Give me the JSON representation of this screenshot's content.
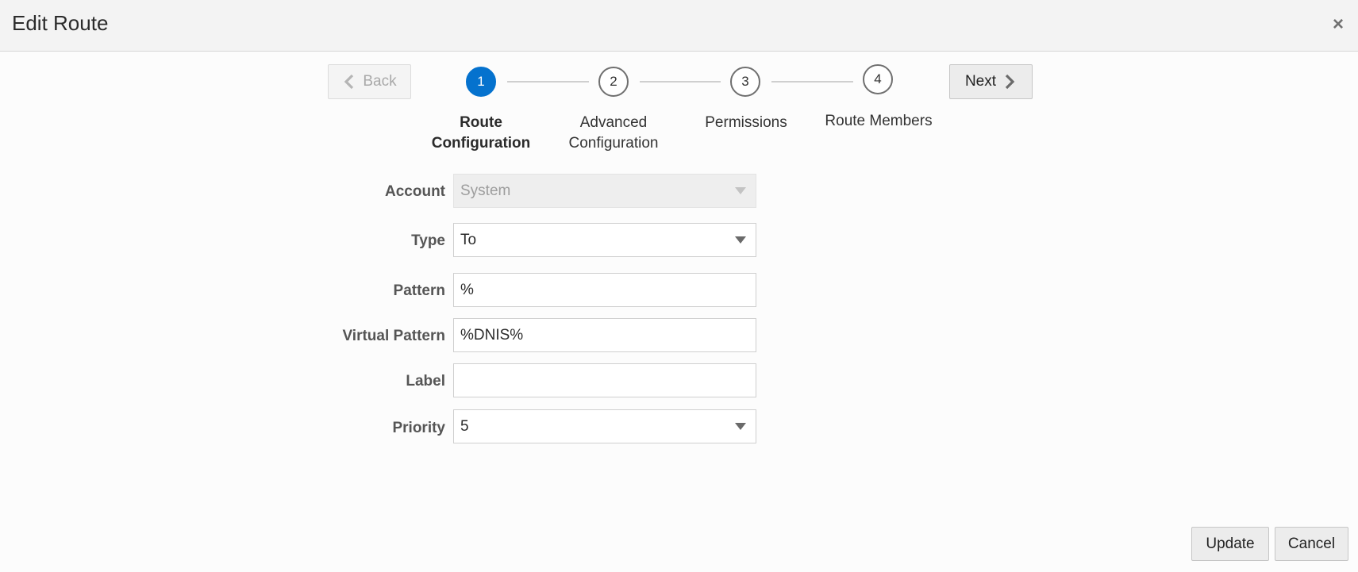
{
  "dialog": {
    "title": "Edit Route",
    "close_glyph": "×"
  },
  "nav": {
    "back_label": "Back",
    "next_label": "Next"
  },
  "steps": [
    {
      "number": "1",
      "label_line1": "Route",
      "label_line2": "Configuration",
      "active": true
    },
    {
      "number": "2",
      "label_line1": "Advanced",
      "label_line2": "Configuration",
      "active": false
    },
    {
      "number": "3",
      "label_line1": "Permissions",
      "label_line2": "",
      "active": false
    },
    {
      "number": "4",
      "label_line1": "Route Members",
      "label_line2": "",
      "active": false
    }
  ],
  "form": {
    "account": {
      "label": "Account",
      "value": "System",
      "disabled": true
    },
    "type": {
      "label": "Type",
      "value": "To"
    },
    "pattern": {
      "label": "Pattern",
      "value": "%"
    },
    "virtual_pattern": {
      "label": "Virtual Pattern",
      "value": "%DNIS%"
    },
    "label": {
      "label": "Label",
      "value": ""
    },
    "priority": {
      "label": "Priority",
      "value": "5"
    }
  },
  "footer": {
    "update_label": "Update",
    "cancel_label": "Cancel"
  },
  "colors": {
    "accent": "#0572ce",
    "header_bg": "#f3f3f3",
    "page_bg": "#fcfcfc"
  }
}
